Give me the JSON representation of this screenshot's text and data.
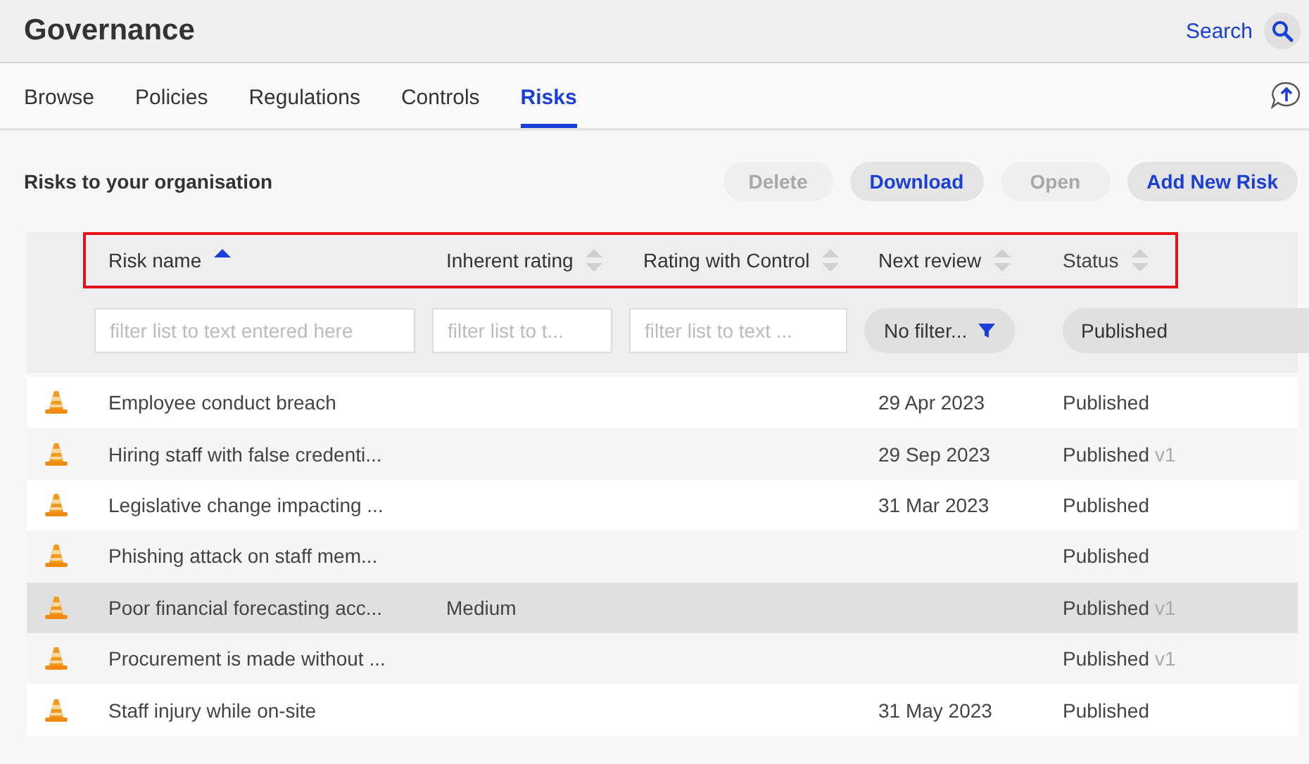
{
  "app": {
    "title": "Governance",
    "search_label": "Search"
  },
  "tabs": [
    {
      "label": "Browse",
      "selected": false
    },
    {
      "label": "Policies",
      "selected": false
    },
    {
      "label": "Regulations",
      "selected": false
    },
    {
      "label": "Controls",
      "selected": false
    },
    {
      "label": "Risks",
      "selected": true
    }
  ],
  "section": {
    "title": "Risks to your organisation"
  },
  "buttons": [
    {
      "label": "Delete",
      "disabled": true
    },
    {
      "label": "Download",
      "disabled": false
    },
    {
      "label": "Open",
      "disabled": true
    },
    {
      "label": "Add New Risk",
      "disabled": false
    }
  ],
  "table": {
    "header_highlighted": true,
    "columns": [
      {
        "label": "Risk name",
        "sorted": true
      },
      {
        "label": "Inherent rating",
        "sorted": false
      },
      {
        "label": "Rating with Control",
        "sorted": false
      },
      {
        "label": "Next review",
        "sorted": false
      },
      {
        "label": "Status",
        "sorted": false
      }
    ],
    "filters": [
      {
        "kind": "text",
        "placeholder": "filter list to text entered here"
      },
      {
        "kind": "text",
        "placeholder": "filter list to t..."
      },
      {
        "kind": "text",
        "placeholder": "filter list to text ..."
      },
      {
        "kind": "dropdown",
        "value": "No filter..."
      },
      {
        "kind": "select",
        "value": "Published"
      }
    ],
    "rows": [
      {
        "name": "Employee conduct breach",
        "next_review": "29 Apr 2023",
        "status": "Published",
        "selected": false
      },
      {
        "name": "Hiring staff with false credenti...",
        "next_review": "29 Sep 2023",
        "status": "Published",
        "version": "v1",
        "selected": false
      },
      {
        "name": "Legislative change impacting ...",
        "next_review": "31 Mar 2023",
        "status": "Published",
        "selected": false
      },
      {
        "name": "Phishing attack on staff mem...",
        "status": "Published",
        "selected": false
      },
      {
        "name": "Poor financial forecasting acc...",
        "inherent": "Medium",
        "status": "Published",
        "version": "v1",
        "selected": true
      },
      {
        "name": "Procurement is made without ...",
        "status": "Published",
        "version": "v1",
        "selected": false
      },
      {
        "name": "Staff injury while on-site",
        "next_review": "31 May 2023",
        "status": "Published",
        "selected": false
      }
    ]
  }
}
